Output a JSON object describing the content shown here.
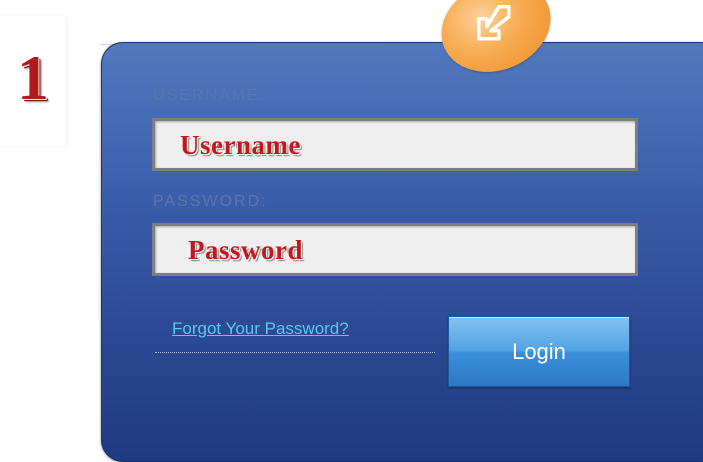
{
  "step": {
    "number": "1"
  },
  "badge": {
    "icon": "arrow-down-left-icon",
    "color": "#f5a340"
  },
  "form": {
    "username_label": "USERNAME:",
    "username_placeholder": "Username",
    "password_label": "PASSWORD:",
    "password_placeholder": "Password",
    "forgot_link": "Forgot Your Password?",
    "login_button": "Login"
  },
  "colors": {
    "panel": "#3b5fab",
    "annotation_text": "#c0181c",
    "link": "#5fc6f2",
    "button": "#4a9be0"
  }
}
